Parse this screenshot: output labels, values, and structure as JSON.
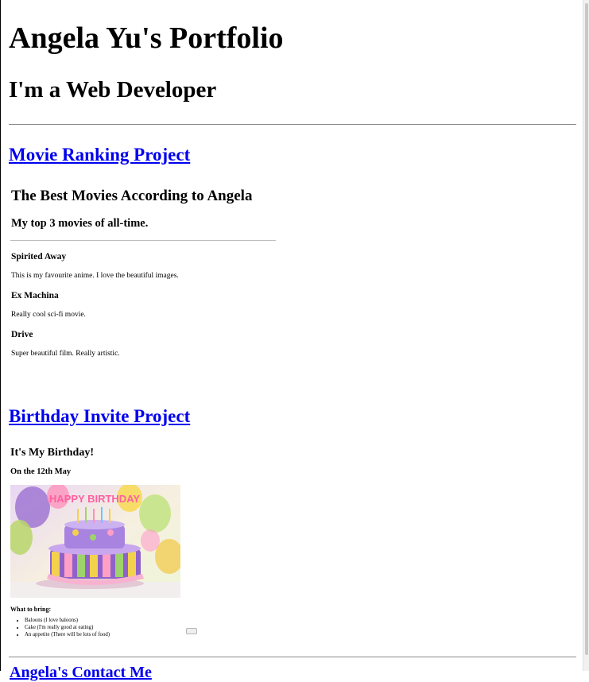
{
  "header": {
    "title": "Angela Yu's Portfolio",
    "subtitle": "I'm a Web Developer"
  },
  "projects": [
    {
      "link": "Movie Ranking Project",
      "preview": {
        "title": "The Best Movies According to Angela",
        "subtitle": "My top 3 movies of all-time.",
        "movies": [
          {
            "name": "Spirited Away",
            "desc": "This is my favourite anime. I love the beautiful images."
          },
          {
            "name": "Ex Machina",
            "desc": "Really cool sci-fi movie."
          },
          {
            "name": "Drive",
            "desc": "Super beautiful film. Really artistic."
          }
        ]
      }
    },
    {
      "link": "Birthday Invite Project",
      "preview": {
        "title": "It's My Birthday!",
        "date": "On the 12th May",
        "cake_banner": "HAPPY BIRTHDAY",
        "bring_heading": "What to bring:",
        "items": [
          "Baloons (I love baloons)",
          "Cake (I'm really good at eating)",
          "An appetite (There will be lots of food)"
        ]
      }
    }
  ],
  "next_link_partial": "Angela's Contact Me",
  "colors": {
    "link": "#0000ee",
    "rule": "#8a8a8a"
  }
}
